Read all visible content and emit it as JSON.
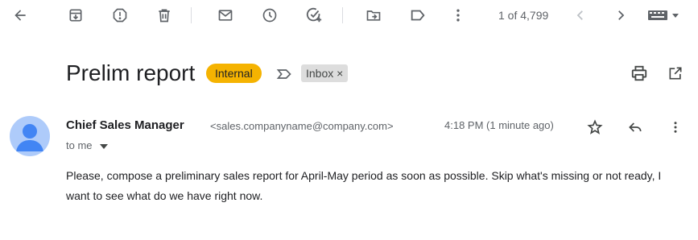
{
  "toolbar": {
    "back_icon": "arrow-left-icon",
    "actions": [
      "archive-icon",
      "report-spam-icon",
      "delete-icon",
      "mark-unread-icon",
      "snooze-icon",
      "add-task-icon",
      "move-to-icon",
      "label-icon",
      "more-vert-icon"
    ],
    "pager": "1 of 4,799",
    "input_tools_icon": "keyboard-icon"
  },
  "email": {
    "subject": "Prelim report",
    "label_chip": "Internal",
    "label_chip_color": "#f5b301",
    "folder_chip": "Inbox",
    "folder_chip_remove": "×",
    "sender_name": "Chief Sales Manager",
    "sender_email": "<sales.companyname@company.com>",
    "time": "4:18 PM (1 minute ago)",
    "recipient": "to me",
    "body": "Please, compose a preliminary sales report for April-May period as soon as possible. Skip what's missing or not ready, I want to see what do we have right now."
  },
  "colors": {
    "icon": "#5f6368",
    "avatar_bg": "#aecbfa",
    "avatar_fg": "#4285f4"
  }
}
